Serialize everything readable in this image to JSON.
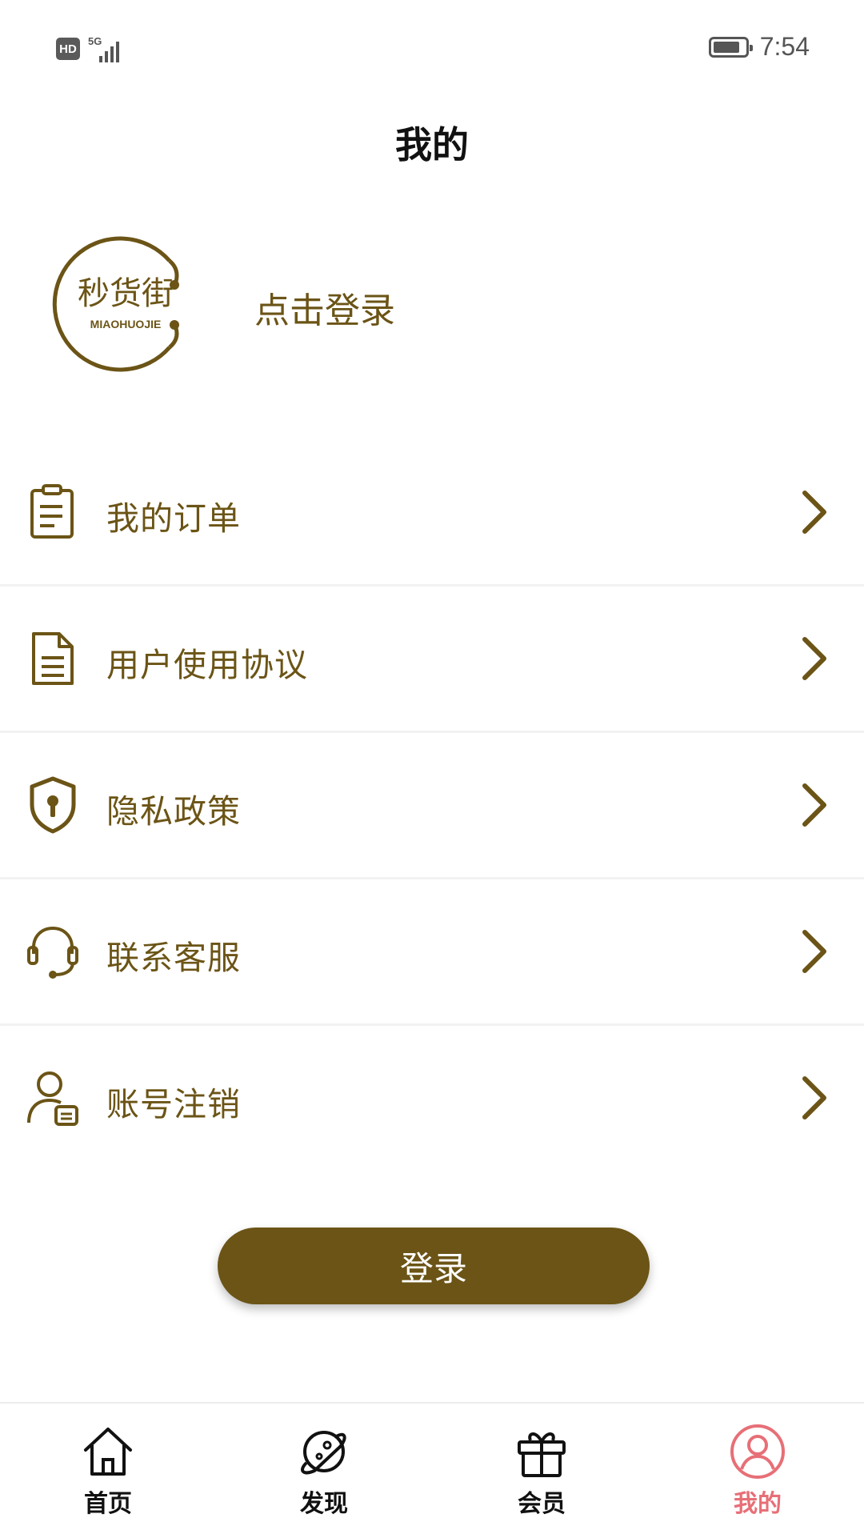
{
  "status_bar": {
    "hd": "HD",
    "network": "5G",
    "time": "7:54",
    "battery_percent": 85
  },
  "header": {
    "title": "我的"
  },
  "profile": {
    "logo_text": "秒货街",
    "logo_subtext": "MIAOHUOJIE",
    "login_prompt": "点击登录"
  },
  "menu": {
    "items": [
      {
        "label": "我的订单",
        "icon": "order-list-icon"
      },
      {
        "label": "用户使用协议",
        "icon": "document-icon"
      },
      {
        "label": "隐私政策",
        "icon": "shield-lock-icon"
      },
      {
        "label": "联系客服",
        "icon": "headset-icon"
      },
      {
        "label": "账号注销",
        "icon": "user-card-icon"
      }
    ]
  },
  "login_button": {
    "label": "登录"
  },
  "tabs": [
    {
      "label": "首页",
      "icon": "home-icon",
      "active": false
    },
    {
      "label": "发现",
      "icon": "planet-icon",
      "active": false
    },
    {
      "label": "会员",
      "icon": "gift-icon",
      "active": false
    },
    {
      "label": "我的",
      "icon": "user-icon",
      "active": true
    }
  ],
  "colors": {
    "brand": "#6b5416",
    "active_tab": "#e76f77",
    "text_dark": "#111111"
  }
}
